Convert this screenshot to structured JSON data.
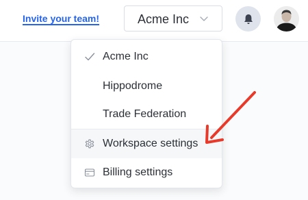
{
  "header": {
    "invite_link": "Invite your team!",
    "workspace_selector": {
      "label": "Acme Inc",
      "icon": "chevron-down-icon"
    },
    "notifications": {
      "icon": "bell-icon"
    },
    "avatar": {
      "icon": "user-avatar"
    }
  },
  "workspace_menu": {
    "workspaces": [
      {
        "label": "Acme Inc",
        "selected": true
      },
      {
        "label": "Hippodrome",
        "selected": false
      },
      {
        "label": "Trade Federation",
        "selected": false
      }
    ],
    "actions": [
      {
        "label": "Workspace settings",
        "icon": "gear-icon"
      },
      {
        "label": "Billing settings",
        "icon": "credit-card-icon"
      }
    ]
  },
  "annotation": {
    "icon": "red-arrow-icon",
    "color": "#e83a2a"
  },
  "colors": {
    "link": "#2563eb",
    "text": "#2b2f36",
    "bell_background": "#dfe4ec",
    "hover_background": "#f6f7f9"
  }
}
